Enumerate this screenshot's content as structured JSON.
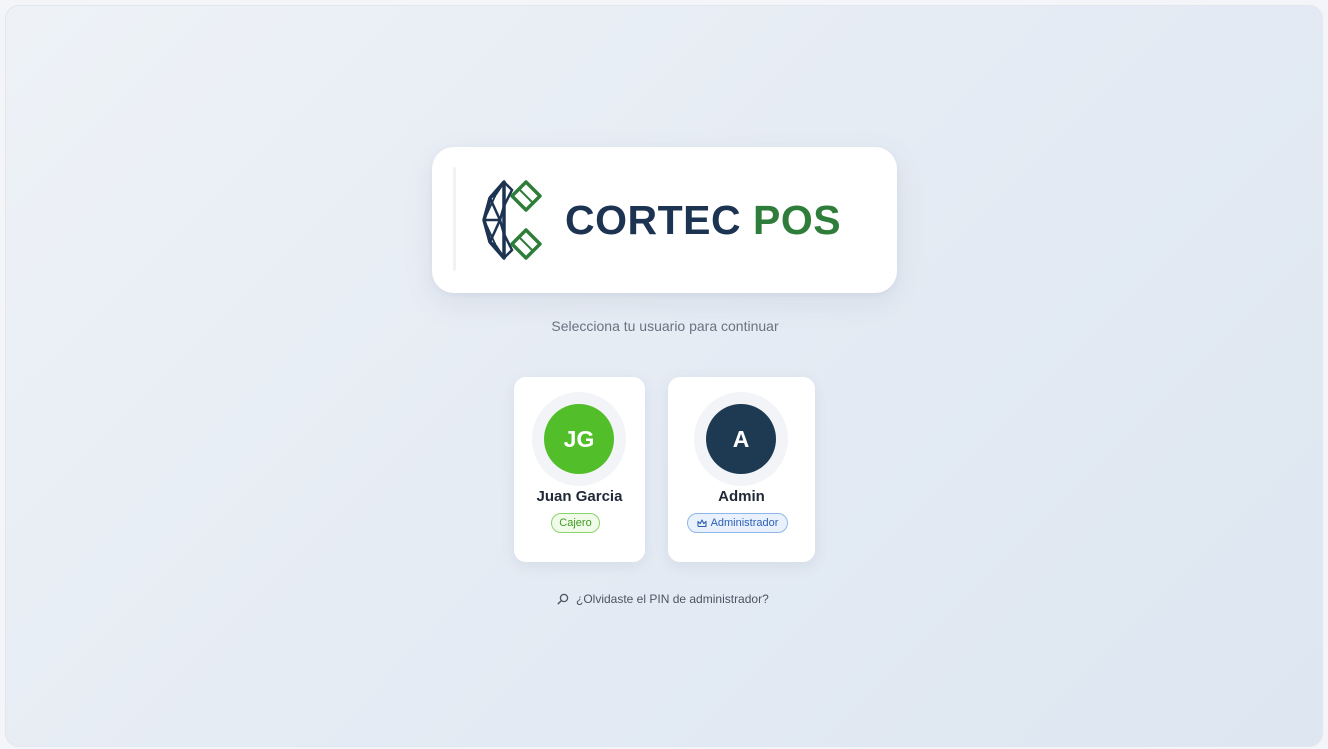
{
  "brand": {
    "name_part1": "CORTEC",
    "name_part2": "POS",
    "logo_icon": "cortec-diamond-logo-icon",
    "colors": {
      "navy": "#1c3352",
      "green": "#2e7d3a"
    }
  },
  "subtitle": "Selecciona tu usuario para continuar",
  "users": [
    {
      "initials": "JG",
      "name": "Juan Garcia",
      "role": "Cajero",
      "avatar_color": "#52bf2a"
    },
    {
      "initials": "A",
      "name": "Admin",
      "role": "Administrador",
      "role_icon": "crown-icon",
      "avatar_color": "#1e3a52"
    }
  ],
  "forgot_pin": {
    "icon": "search-icon",
    "label": "¿Olvidaste el PIN de administrador?"
  }
}
